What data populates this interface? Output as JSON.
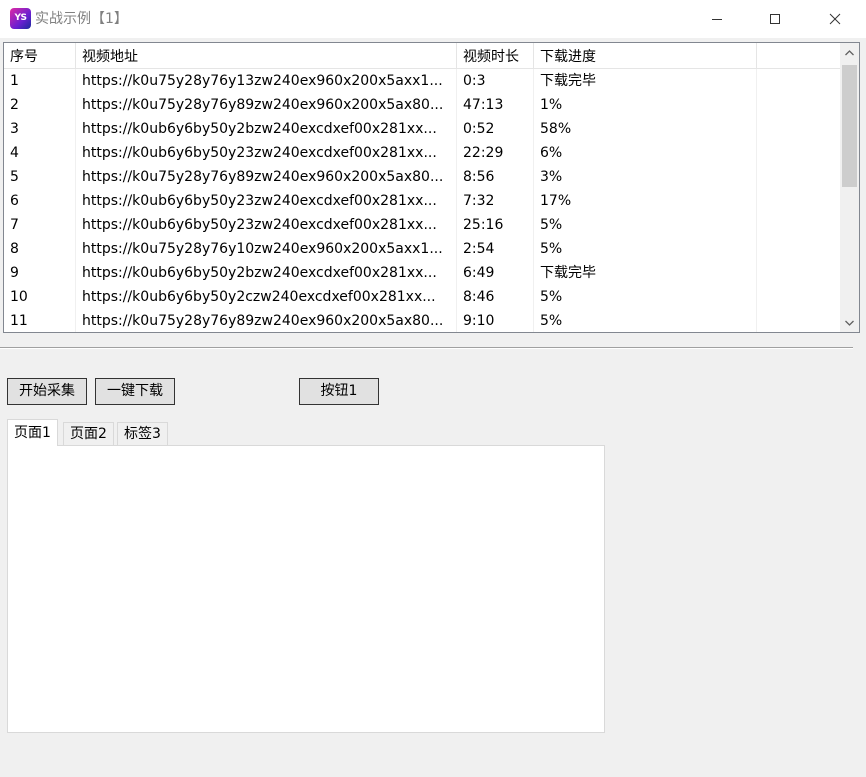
{
  "window": {
    "icon_text": "YS",
    "title": "实战示例【1】",
    "minimize_icon": "minimize-icon",
    "maximize_icon": "maximize-icon",
    "close_icon": "close-icon"
  },
  "table": {
    "columns": [
      "序号",
      "视频地址",
      "视频时长",
      "下载进度",
      ""
    ],
    "rows": [
      {
        "no": "1",
        "url": "https://k0u75y28y76y13zw240ex960x200x5axx1...",
        "duration": "0:3",
        "progress": "下载完毕"
      },
      {
        "no": "2",
        "url": "https://k0u75y28y76y89zw240ex960x200x5ax80...",
        "duration": "47:13",
        "progress": "1%"
      },
      {
        "no": "3",
        "url": "https://k0ub6y6by50y2bzw240excdxef00x281xx...",
        "duration": "0:52",
        "progress": "58%"
      },
      {
        "no": "4",
        "url": "https://k0ub6y6by50y23zw240excdxef00x281xx...",
        "duration": "22:29",
        "progress": "6%"
      },
      {
        "no": "5",
        "url": "https://k0u75y28y76y89zw240ex960x200x5ax80...",
        "duration": "8:56",
        "progress": "3%"
      },
      {
        "no": "6",
        "url": "https://k0ub6y6by50y23zw240excdxef00x281xx...",
        "duration": "7:32",
        "progress": "17%"
      },
      {
        "no": "7",
        "url": "https://k0ub6y6by50y23zw240excdxef00x281xx...",
        "duration": "25:16",
        "progress": "5%"
      },
      {
        "no": "8",
        "url": "https://k0u75y28y76y10zw240ex960x200x5axx1...",
        "duration": "2:54",
        "progress": "5%"
      },
      {
        "no": "9",
        "url": "https://k0ub6y6by50y2bzw240excdxef00x281xx...",
        "duration": "6:49",
        "progress": "下载完毕"
      },
      {
        "no": "10",
        "url": "https://k0ub6y6by50y2czw240excdxef00x281xx...",
        "duration": "8:46",
        "progress": "5%"
      },
      {
        "no": "11",
        "url": "https://k0u75y28y76y89zw240ex960x200x5ax80...",
        "duration": "9:10",
        "progress": "5%"
      }
    ]
  },
  "buttons": {
    "start": "开始采集",
    "download_all": "一键下载",
    "button1": "按钮1"
  },
  "tabs": [
    "页面1",
    "页面2",
    "标签3"
  ],
  "active_tab": "页面1"
}
